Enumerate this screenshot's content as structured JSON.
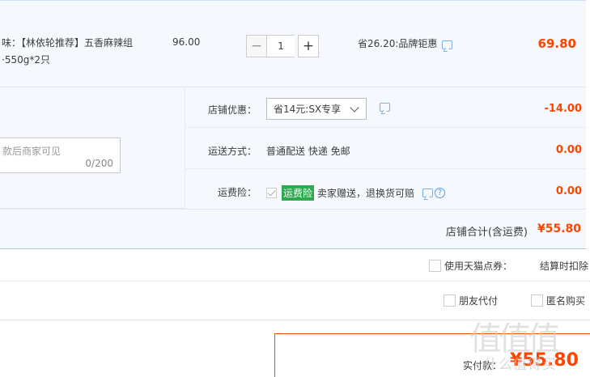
{
  "item": {
    "title": "味：【林依轮推荐】五香麻辣组 ·550g*2只",
    "unit_price": "96.00",
    "quantity": "1",
    "qty_minus": "−",
    "qty_plus": "+",
    "discount_text": "省26.20:品牌钜惠",
    "total": "69.80"
  },
  "message": {
    "placeholder": "款后商家可见",
    "count": "0/200"
  },
  "shop_options": {
    "coupon": {
      "label": "店铺优惠：",
      "selected": "省14元:SX专享",
      "amount": "-14.00"
    },
    "shipping": {
      "label": "运送方式：",
      "value": "普通配送 快递 免邮",
      "amount": "0.00"
    },
    "insurance": {
      "label": "运费险：",
      "badge": "运费险",
      "text": "卖家赠送，退换货可赔",
      "amount": "0.00"
    }
  },
  "shop_total": {
    "label": "店铺合计(含运费)",
    "value": "¥55.80"
  },
  "tmall_points": {
    "label": "使用天猫点券：",
    "hint": "结算时扣除"
  },
  "order_options": {
    "friend_pay": "朋友代付",
    "anonymous": "匿名购买"
  },
  "payment": {
    "label": "实付款：",
    "value": "¥55.80"
  },
  "watermark": {
    "logo": "值值值",
    "site": "什么值得买"
  },
  "colors": {
    "accent": "#ff4400",
    "row_bg": "#f5f8fd",
    "badge_green": "#2da94f",
    "icon_blue": "#5a9ed8"
  },
  "icons": [
    "chat-icon",
    "help-icon",
    "chevron-down-icon",
    "checkbox-icon"
  ]
}
